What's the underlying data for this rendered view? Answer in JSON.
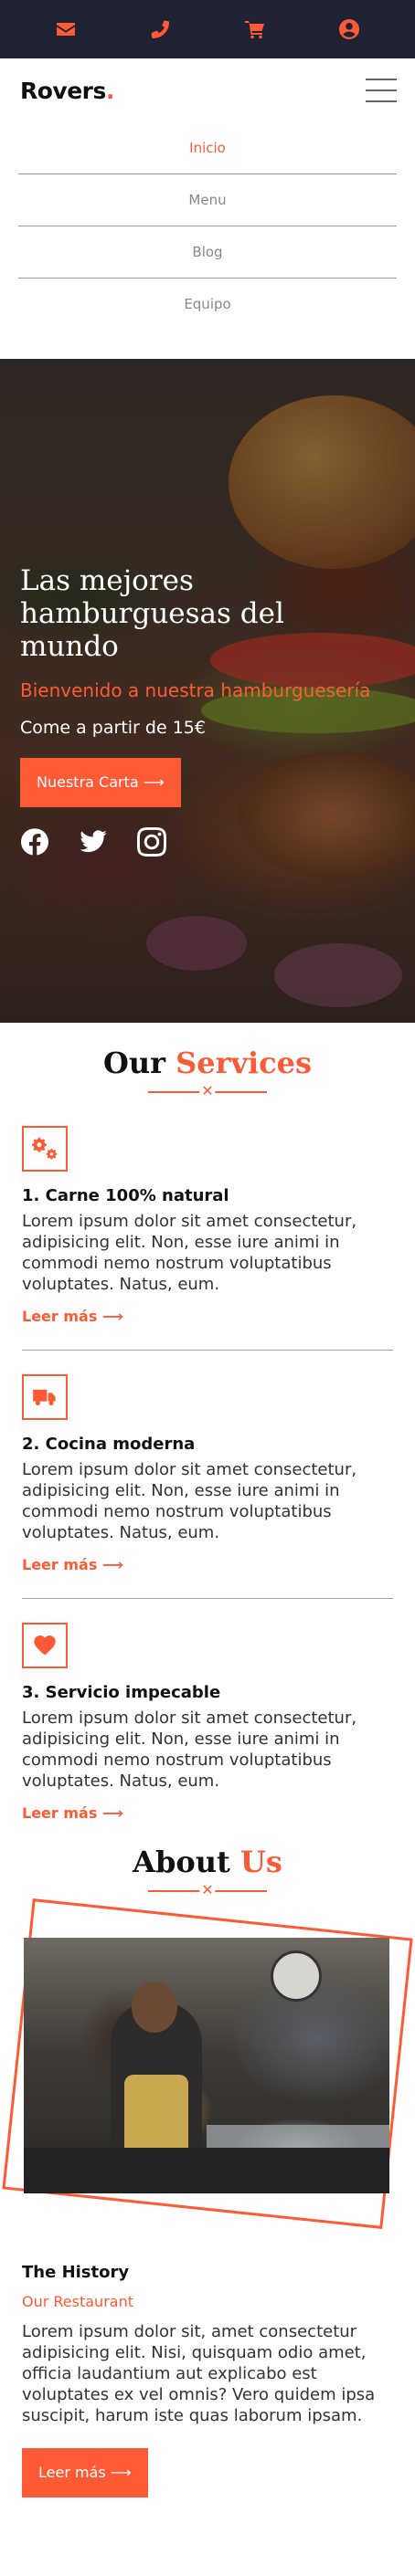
{
  "topbar": {
    "icons": [
      "envelope-icon",
      "phone-icon",
      "cart-icon",
      "user-icon"
    ]
  },
  "header": {
    "logo_text": "Rovers",
    "logo_dot": ".",
    "menu_icon": "hamburger-icon"
  },
  "nav": {
    "items": [
      {
        "label": "Inicio",
        "active": true
      },
      {
        "label": "Menu",
        "active": false
      },
      {
        "label": "Blog",
        "active": false
      },
      {
        "label": "Equipo",
        "active": false
      }
    ]
  },
  "hero": {
    "title": "Las mejores hamburguesas del mundo",
    "subtitle": "Bienvenido a nuestra hamburguesería",
    "price": "Come a partir de 15€",
    "cta": "Nuestra Carta ⟶",
    "socials": [
      "facebook-icon",
      "twitter-icon",
      "instagram-icon"
    ]
  },
  "services": {
    "title_main": "Our",
    "title_accent": "Services",
    "items": [
      {
        "icon": "gears-icon",
        "title": "1. Carne 100% natural",
        "text": "Lorem ipsum dolor sit amet consectetur, adipisicing elit. Non, esse iure animi in commodi nemo nostrum voluptatibus voluptates. Natus, eum.",
        "more": "Leer más ⟶"
      },
      {
        "icon": "truck-icon",
        "title": "2. Cocina moderna",
        "text": "Lorem ipsum dolor sit amet consectetur, adipisicing elit. Non, esse iure animi in commodi nemo nostrum voluptatibus voluptates. Natus, eum.",
        "more": "Leer más ⟶"
      },
      {
        "icon": "heart-icon",
        "title": "3. Servicio impecable",
        "text": "Lorem ipsum dolor sit amet consectetur, adipisicing elit. Non, esse iure animi in commodi nemo nostrum voluptatibus voluptates. Natus, eum.",
        "more": "Leer más ⟶"
      }
    ]
  },
  "about": {
    "title_main": "About",
    "title_accent": "Us",
    "heading": "The History",
    "tag": "Our Restaurant",
    "text": "Lorem ipsum dolor sit, amet consectetur adipisicing elit. Nisi, quisquam odio amet, officia laudantium aut explicabo est voluptates ex vel omnis? Vero quidem ipsa suscipit, harum iste quas laborum ipsam.",
    "cta": "Leer más ⟶"
  },
  "colors": {
    "accent": "#ff5a36",
    "topbar_bg": "#1f2233"
  }
}
